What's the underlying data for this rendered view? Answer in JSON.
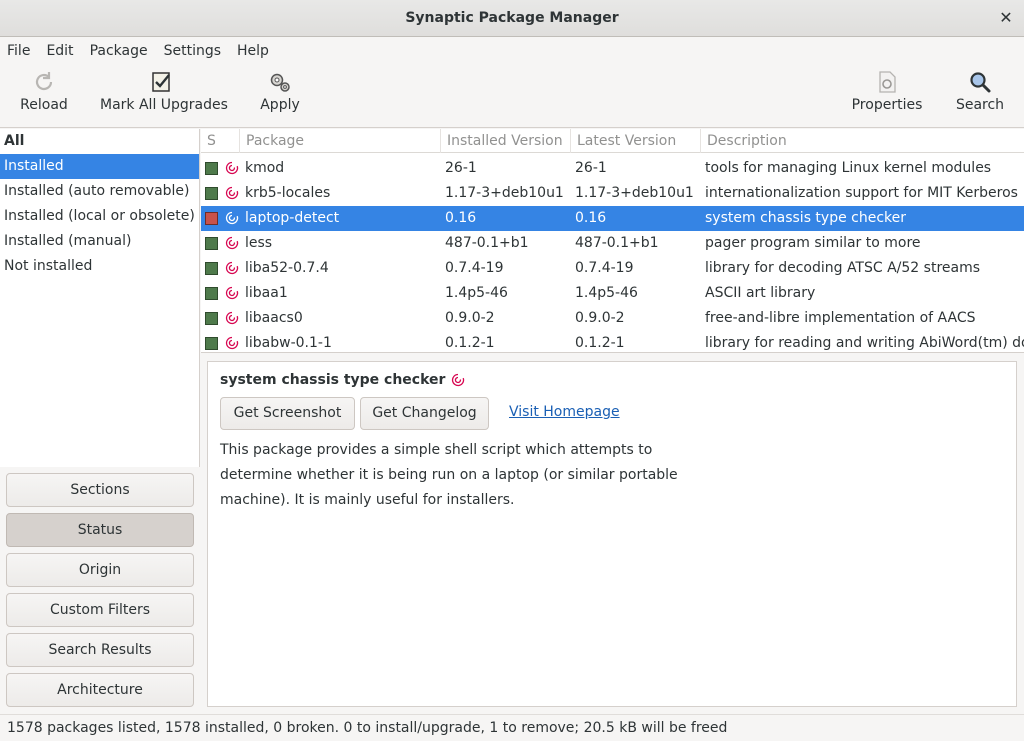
{
  "window": {
    "title": "Synaptic Package Manager"
  },
  "menu": [
    "File",
    "Edit",
    "Package",
    "Settings",
    "Help"
  ],
  "toolbar": {
    "reload": "Reload",
    "mark_all_upgrades": "Mark All Upgrades",
    "apply": "Apply",
    "properties": "Properties",
    "search": "Search"
  },
  "filters": {
    "header": "All",
    "items": [
      "Installed",
      "Installed (auto removable)",
      "Installed (local or obsolete)",
      "Installed (manual)",
      "Not installed"
    ]
  },
  "view_buttons": {
    "sections": "Sections",
    "status": "Status",
    "origin": "Origin",
    "custom_filters": "Custom Filters",
    "search_results": "Search Results",
    "architecture": "Architecture"
  },
  "table": {
    "headers": {
      "s": "S",
      "package": "Package",
      "installed": "Installed Version",
      "latest": "Latest Version",
      "description": "Description"
    },
    "rows": [
      {
        "name": "",
        "installed": "",
        "latest": "",
        "description": "",
        "partial": true
      },
      {
        "name": "kmod",
        "installed": "26-1",
        "latest": "26-1",
        "description": "tools for managing Linux kernel modules"
      },
      {
        "name": "krb5-locales",
        "installed": "1.17-3+deb10u1",
        "latest": "1.17-3+deb10u1",
        "description": "internationalization support for MIT Kerberos"
      },
      {
        "name": "laptop-detect",
        "installed": "0.16",
        "latest": "0.16",
        "description": "system chassis type checker",
        "selected": true,
        "remove": true
      },
      {
        "name": "less",
        "installed": "487-0.1+b1",
        "latest": "487-0.1+b1",
        "description": "pager program similar to more"
      },
      {
        "name": "liba52-0.7.4",
        "installed": "0.7.4-19",
        "latest": "0.7.4-19",
        "description": "library for decoding ATSC A/52 streams"
      },
      {
        "name": "libaa1",
        "installed": "1.4p5-46",
        "latest": "1.4p5-46",
        "description": "ASCII art library"
      },
      {
        "name": "libaacs0",
        "installed": "0.9.0-2",
        "latest": "0.9.0-2",
        "description": "free-and-libre implementation of AACS"
      },
      {
        "name": "libabw-0.1-1",
        "installed": "0.1.2-1",
        "latest": "0.1.2-1",
        "description": "library for reading and writing AbiWord(tm) docu"
      }
    ]
  },
  "details": {
    "title": "system chassis type checker",
    "get_screenshot": "Get Screenshot",
    "get_changelog": "Get Changelog",
    "visit_homepage": "Visit Homepage",
    "description": "This package provides a simple shell script which attempts to determine whether it is being run on a laptop (or similar portable machine). It is mainly useful for installers."
  },
  "statusbar": "1578 packages listed, 1578 installed, 0 broken. 0 to install/upgrade, 1 to remove; 20.5 kB will be freed",
  "colors": {
    "selection": "#3584e4",
    "installed": "#4e7a4b",
    "remove": "#c8524a",
    "link": "#1a5fb4",
    "debian": "#d70751"
  }
}
